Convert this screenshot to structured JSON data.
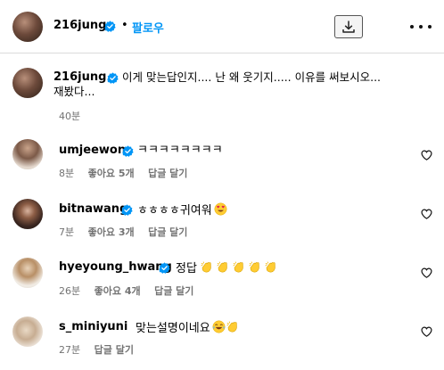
{
  "header": {
    "username": "216jung",
    "dot": "•",
    "follow_label": "팔로우"
  },
  "caption": {
    "username": "216jung",
    "line1": "이게 맞는답인지.... 난 왜 웃기지..... 이유를 써보시오...",
    "line2": "재봤다...",
    "time": "40분"
  },
  "comments": [
    {
      "username": "umjeewon",
      "text": "ㅋㅋㅋㅋㅋㅋㅋㅋ",
      "time": "8분",
      "likes": "좋아요 5개",
      "reply": "답글 달기"
    },
    {
      "username": "bitnawang",
      "text": "ㅎㅎㅎㅎ귀여워",
      "time": "7분",
      "likes": "좋아요 3개",
      "reply": "답글 달기"
    },
    {
      "username": "hyeyoung_hwang",
      "text": "정답",
      "time": "26분",
      "likes": "좋아요 4개",
      "reply": "답글 달기"
    },
    {
      "username": "s_miniyuni",
      "text": "맞는설명이네요",
      "time": "27분",
      "reply": "답글 달기"
    }
  ],
  "icons": {
    "download": "download-icon",
    "more": "more-options-icon",
    "verified": "verified-badge-icon",
    "heart": "heart-outline-icon",
    "clap": "clapping-hands-emoji",
    "heart_eyes": "heart-eyes-emoji",
    "laughing": "tears-of-joy-emoji"
  },
  "colors": {
    "accent": "#0095f6",
    "verified": "#0095f6",
    "meta": "#737373",
    "divider": "#dbdbdb"
  }
}
